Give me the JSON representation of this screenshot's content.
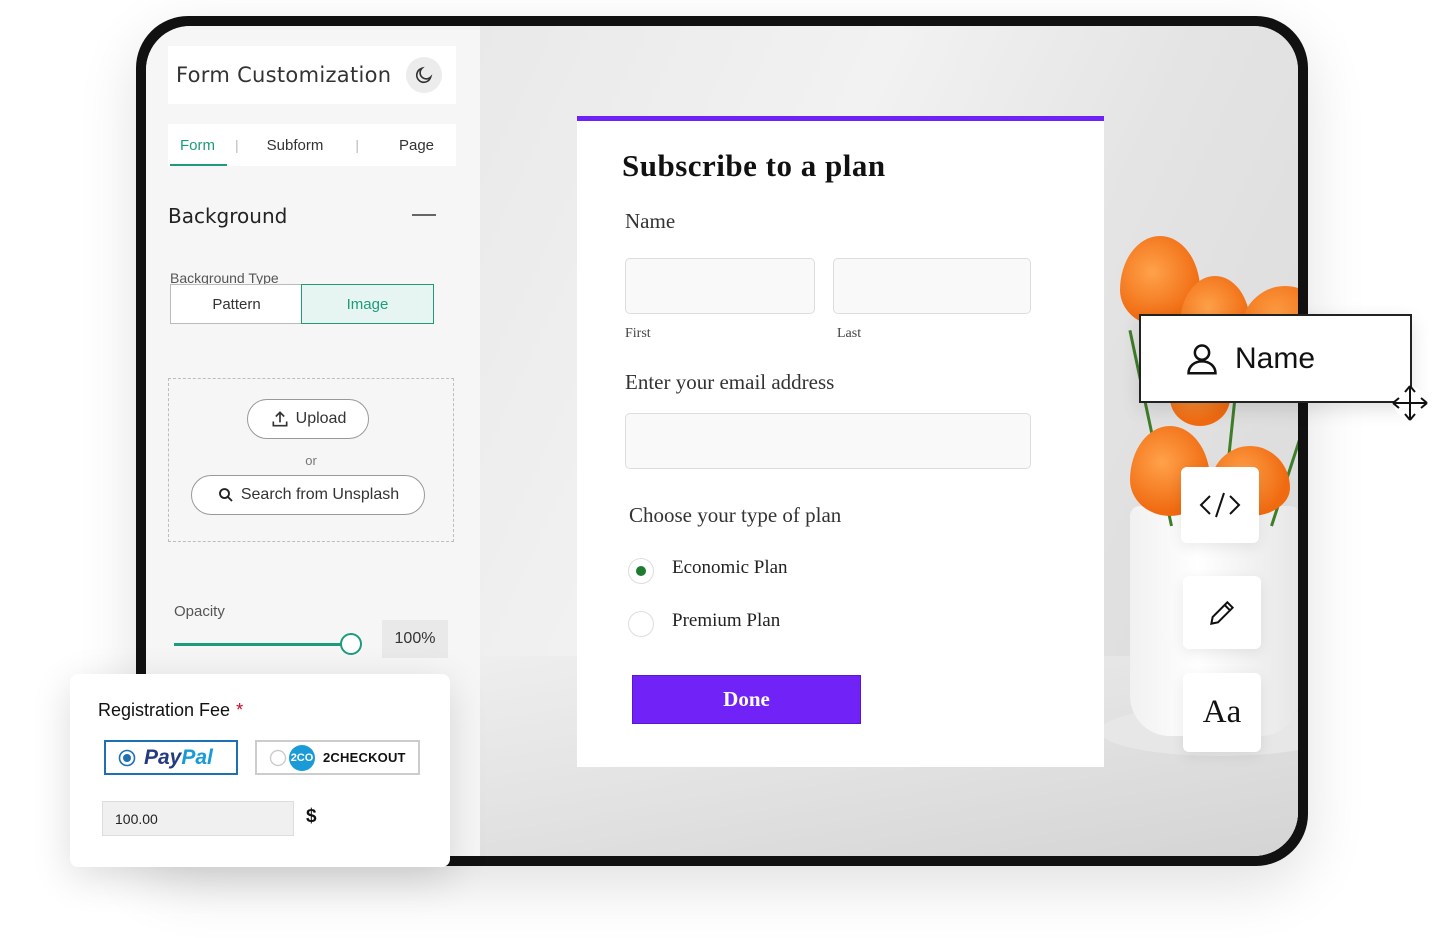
{
  "sidebar": {
    "title": "Form Customization",
    "tabs": [
      {
        "label": "Form"
      },
      {
        "label": "Subform"
      },
      {
        "label": "Page"
      }
    ],
    "section_title": "Background",
    "background_type_label": "Background Type",
    "background_options": [
      {
        "label": "Pattern"
      },
      {
        "label": "Image"
      }
    ],
    "upload_label": "Upload",
    "or_label": "or",
    "unsplash_label": "Search from Unsplash",
    "opacity_label": "Opacity",
    "opacity_value": "100%"
  },
  "form": {
    "title": "Subscribe to a plan",
    "name_label": "Name",
    "first_label": "First",
    "last_label": "Last",
    "email_label": "Enter your email address",
    "plan_label": "Choose your type of plan",
    "plans": [
      {
        "label": "Economic Plan"
      },
      {
        "label": "Premium Plan"
      }
    ],
    "submit_label": "Done",
    "accent_color": "#6e22f5"
  },
  "tools": {
    "name_chip_label": "Name",
    "font_tool_label": "Aa"
  },
  "registration": {
    "title": "Registration Fee",
    "required_mark": "*",
    "paypal_part1": "Pay",
    "paypal_part2": "Pal",
    "twocheckout_badge": "2CO",
    "twocheckout_label": "2CHECKOUT",
    "amount": "100.00",
    "currency": "$"
  }
}
